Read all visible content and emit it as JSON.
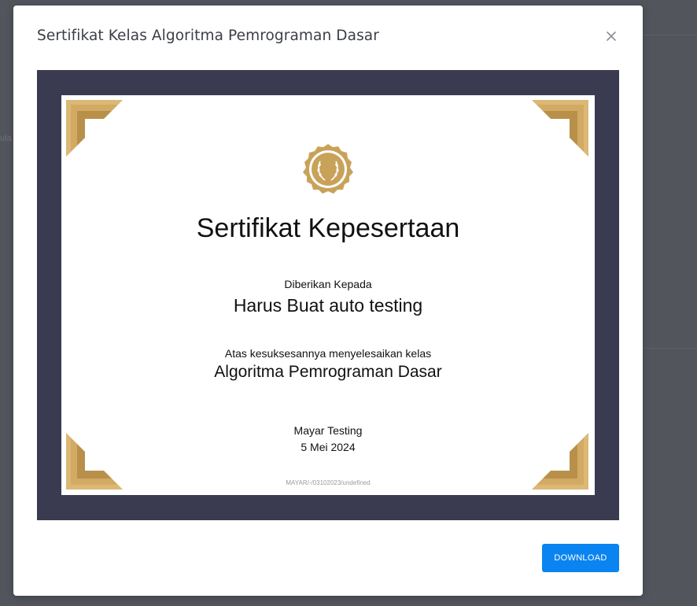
{
  "background": {
    "partial_text": "ula"
  },
  "modal": {
    "title": "Sertifikat Kelas Algoritma Pemrograman Dasar",
    "close_icon": "close-icon",
    "download_label": "DOWNLOAD"
  },
  "certificate": {
    "heading": "Sertifikat Kepesertaan",
    "given_to_label": "Diberikan Kepada",
    "recipient_name": "Harus Buat auto testing",
    "success_label": "Atas kesuksesannya menyelesaikan kelas",
    "course_name": "Algoritma Pemrograman Dasar",
    "issuer": "Mayar Testing",
    "date": "5 Mei 2024",
    "certificate_id": "MAYAR/-/03102023/undefined",
    "seal_icon": "laurel-seal-icon",
    "colors": {
      "frame": "#3a3b51",
      "gold": "#c9a25a",
      "accent_button": "#0a84f0"
    }
  }
}
